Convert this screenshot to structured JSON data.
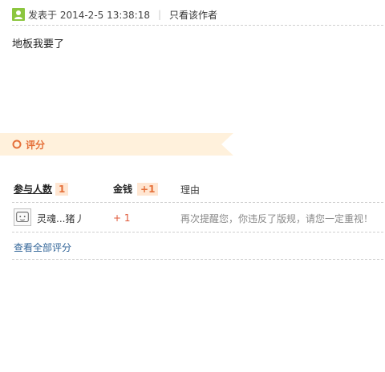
{
  "post": {
    "posted_label": "发表于 2014-2-5 13:38:18",
    "divider": "|",
    "author_only": "只看该作者",
    "content": "地板我要了"
  },
  "rating": {
    "section_title": "评分",
    "header": {
      "participants_label": "参与人数",
      "participants_count": "1",
      "money_label": "金钱",
      "money_total": "+1",
      "reason_label": "理由"
    },
    "rows": [
      {
        "name": "灵魂...猪丿",
        "money": "+ 1",
        "reason": "再次提醒您，你违反了版规，请您一定重视！"
      }
    ],
    "view_all": "查看全部评分"
  },
  "colors": {
    "accent": "#e5703a",
    "banner_bg": "#fff1dc",
    "link": "#336699",
    "online_icon": "#8cc63f"
  },
  "icons": {
    "online": "user-online-icon",
    "section": "ring-icon"
  }
}
